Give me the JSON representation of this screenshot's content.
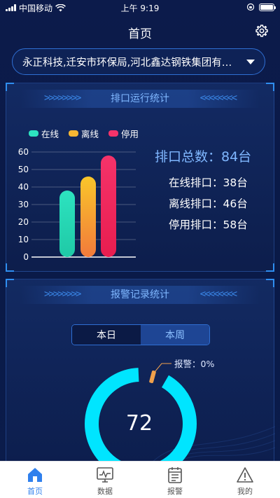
{
  "status_bar": {
    "carrier": "中国移动",
    "time": "上午 9:19"
  },
  "nav": {
    "title": "首页",
    "settings_icon": "gear-icon"
  },
  "selector": {
    "value": "永正科技,迁安市环保局,河北鑫达钢铁集团有…"
  },
  "outlet_panel": {
    "title": "排口运行统计",
    "total_label": "排口总数：84台",
    "stats": [
      {
        "label": "在线排口：38台"
      },
      {
        "label": "离线排口：46台"
      },
      {
        "label": "停用排口：58台"
      }
    ]
  },
  "chart_data": {
    "type": "bar",
    "categories": [
      "在线",
      "离线",
      "停用"
    ],
    "values": [
      38,
      46,
      58
    ],
    "colors": [
      "#2de3c0",
      "#f7b733",
      "#f5336a"
    ],
    "legend": [
      "在线",
      "离线",
      "停用"
    ],
    "yticks": [
      "0",
      "10",
      "20",
      "30",
      "40",
      "50",
      "60"
    ],
    "ylim": [
      0,
      60
    ],
    "grid": true,
    "legend_position": "top-left"
  },
  "alarm_panel": {
    "title": "报警记录统计",
    "tabs": [
      {
        "label": "本日",
        "active": true
      },
      {
        "label": "本周",
        "active": false
      }
    ],
    "alarm_label": "报警：0%",
    "ring_value": "72",
    "alarm_fraction": 0.0
  },
  "tabbar": {
    "items": [
      {
        "label": "首页",
        "icon": "home-icon",
        "active": true
      },
      {
        "label": "数据",
        "icon": "monitor-icon",
        "active": false
      },
      {
        "label": "报警",
        "icon": "calendar-icon",
        "active": false
      },
      {
        "label": "我的",
        "icon": "warning-icon",
        "active": false
      }
    ]
  },
  "colors": {
    "accent": "#2f80ed",
    "ring": "#00e5ff",
    "title": "#7fb7ff"
  }
}
